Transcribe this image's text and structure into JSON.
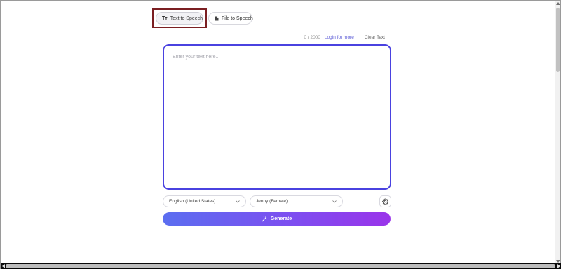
{
  "tabs": {
    "text_to_speech": {
      "icon": "Tт",
      "label": "Text to Speech"
    },
    "file_to_speech": {
      "label": "File to Speech"
    }
  },
  "info": {
    "counter": "0 / 2000",
    "login_link": "Login for more",
    "clear_text": "Clear Text"
  },
  "editor": {
    "placeholder": "Enter your text here...",
    "value": ""
  },
  "controls": {
    "language": "English (United States)",
    "voice": "Jenny (Female)",
    "generate_label": "Generate"
  },
  "colors": {
    "accent": "#4a42e0",
    "highlight_border": "#7b1f22",
    "generate_gradient_start": "#5b6ef0",
    "generate_gradient_end": "#9a34ea"
  },
  "icons": {
    "text_tab": "text-format-icon",
    "file_tab": "file-icon",
    "settings": "gear-icon",
    "generate": "magic-wand-icon",
    "select_arrow": "chevron-down-icon"
  }
}
